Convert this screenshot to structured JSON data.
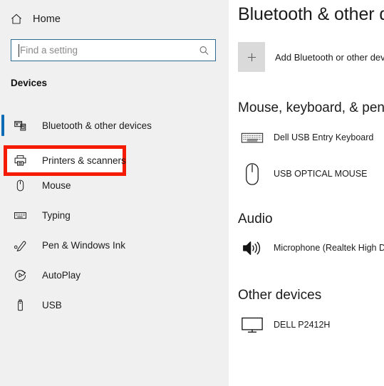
{
  "sidebar": {
    "home": {
      "label": "Home",
      "icon": "home-icon"
    },
    "search": {
      "value": "",
      "placeholder": "Find a setting",
      "icon": "search-icon"
    },
    "section_header": "Devices",
    "items": [
      {
        "label": "Bluetooth & other devices",
        "icon": "bluetooth-devices-icon",
        "selected": true
      },
      {
        "label": "Printers & scanners",
        "icon": "printer-icon",
        "selected": false,
        "highlighted": true
      },
      {
        "label": "Mouse",
        "icon": "mouse-icon",
        "selected": false
      },
      {
        "label": "Typing",
        "icon": "keyboard-icon",
        "selected": false
      },
      {
        "label": "Pen & Windows Ink",
        "icon": "pen-icon",
        "selected": false
      },
      {
        "label": "AutoPlay",
        "icon": "autoplay-icon",
        "selected": false
      },
      {
        "label": "USB",
        "icon": "usb-icon",
        "selected": false
      }
    ],
    "accent_color": "#0b6cb5",
    "background_color": "#f0f0f0"
  },
  "annotation": {
    "target": "Printers & scanners",
    "color": "#f51b00"
  },
  "main": {
    "title": "Bluetooth & other devices",
    "add_device": {
      "label": "Add Bluetooth or other devices",
      "icon": "plus-icon"
    },
    "groups": [
      {
        "title": "Mouse, keyboard, & pen",
        "devices": [
          {
            "label": "Dell USB Entry Keyboard",
            "icon": "keyboard-icon"
          },
          {
            "label": "USB OPTICAL MOUSE",
            "icon": "mouse-icon"
          }
        ]
      },
      {
        "title": "Audio",
        "devices": [
          {
            "label": "Microphone (Realtek High Definition Audio)",
            "icon": "speaker-icon"
          }
        ]
      },
      {
        "title": "Other devices",
        "devices": [
          {
            "label": "DELL P2412H",
            "icon": "monitor-icon"
          }
        ]
      }
    ]
  }
}
